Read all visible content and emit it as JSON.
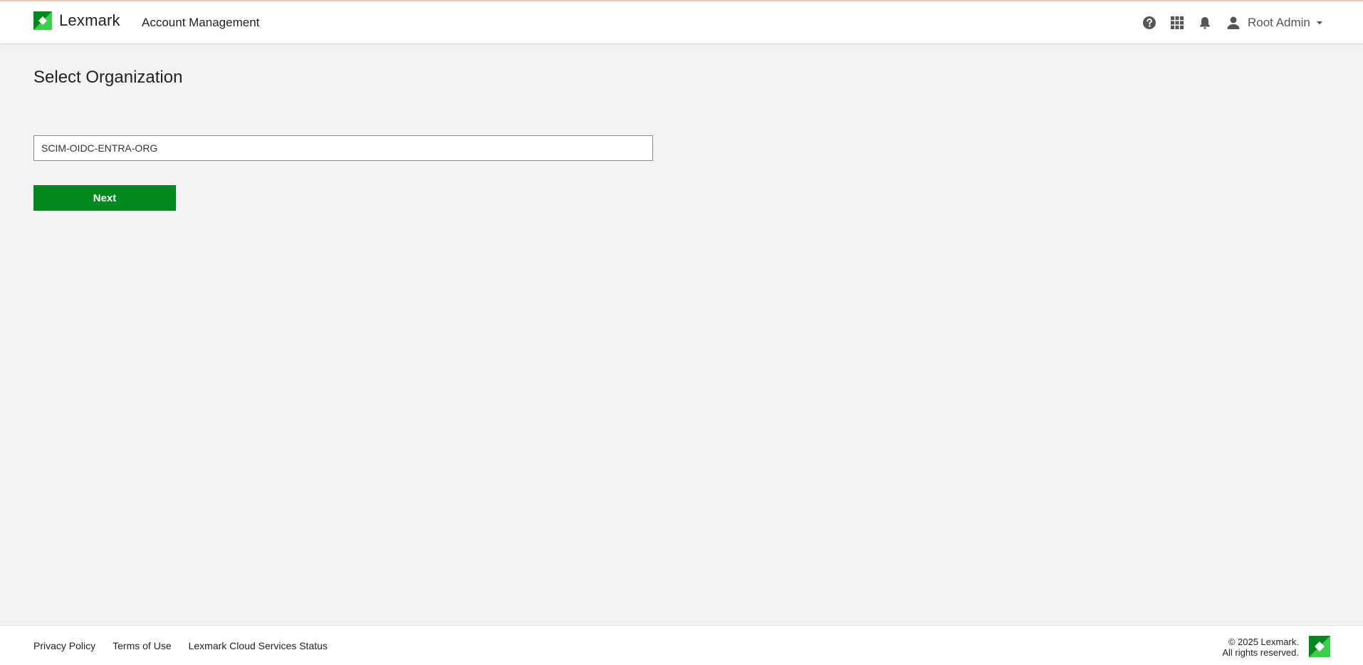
{
  "header": {
    "brand_name": "Lexmark",
    "app_title": "Account Management",
    "icons": [
      "help-icon",
      "apps-grid-icon",
      "bell-icon",
      "user-icon"
    ],
    "user_name": "Root Admin"
  },
  "main": {
    "title": "Select Organization",
    "organization_field": {
      "value": "SCIM-OIDC-ENTRA-ORG",
      "placeholder": ""
    },
    "next_label": "Next"
  },
  "footer": {
    "links": [
      "Privacy Policy",
      "Terms of Use",
      "Lexmark Cloud Services Status"
    ],
    "copyright_line1": "© 2025 Lexmark.",
    "copyright_line2": "All rights reserved."
  },
  "colors": {
    "brand_green": "#008a1e",
    "logo_light_green": "#3ad04a",
    "page_background": "#f3f3f3"
  }
}
